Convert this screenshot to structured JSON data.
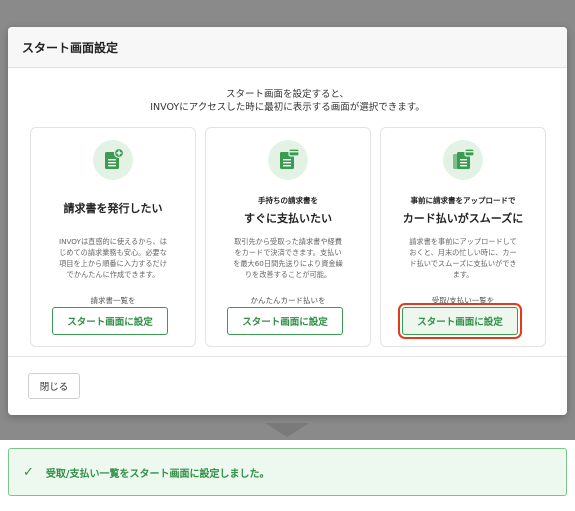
{
  "modal": {
    "title": "スタート画面設定",
    "intro_line1": "スタート画面を設定すると、",
    "intro_line2": "INVOYにアクセスした時に最初に表示する画面が選択できます。",
    "close_label": "閉じる"
  },
  "cards": [
    {
      "small": "",
      "title": "請求書を発行したい",
      "desc": [
        "INVOYは直感的に使えるから、は",
        "じめての請求業務も安心。必要な",
        "項目を上から順番に入力するだけ",
        "でかんたんに作成できます。"
      ],
      "caption": "請求書一覧を",
      "button": "スタート画面に設定",
      "icon": "invoice-add-icon"
    },
    {
      "small": "手持ちの請求書を",
      "title": "すぐに支払いたい",
      "desc": [
        "取引先から受取った請求書や経費",
        "をカードで決済できます。支払い",
        "を最大60日間先送りにより資金繰",
        "りを改善することが可能。"
      ],
      "caption": "かんたんカード払いを",
      "button": "スタート画面に設定",
      "icon": "invoice-pay-icon"
    },
    {
      "small": "事前に請求書をアップロードで",
      "title": "カード払いがスムーズに",
      "desc": [
        "請求書を事前にアップロードして",
        "おくと、月末の忙しい時に、カー",
        "ド払いでスムーズに支払いができ",
        "ます。"
      ],
      "caption": "受取/支払い一覧を",
      "button": "スタート画面に設定",
      "icon": "invoice-upload-icon"
    }
  ],
  "toast": {
    "message": "受取/支払い一覧をスタート画面に設定しました。",
    "icon": "check-icon"
  },
  "colors": {
    "accent": "#2f8f46",
    "highlight": "#e23b1c"
  }
}
